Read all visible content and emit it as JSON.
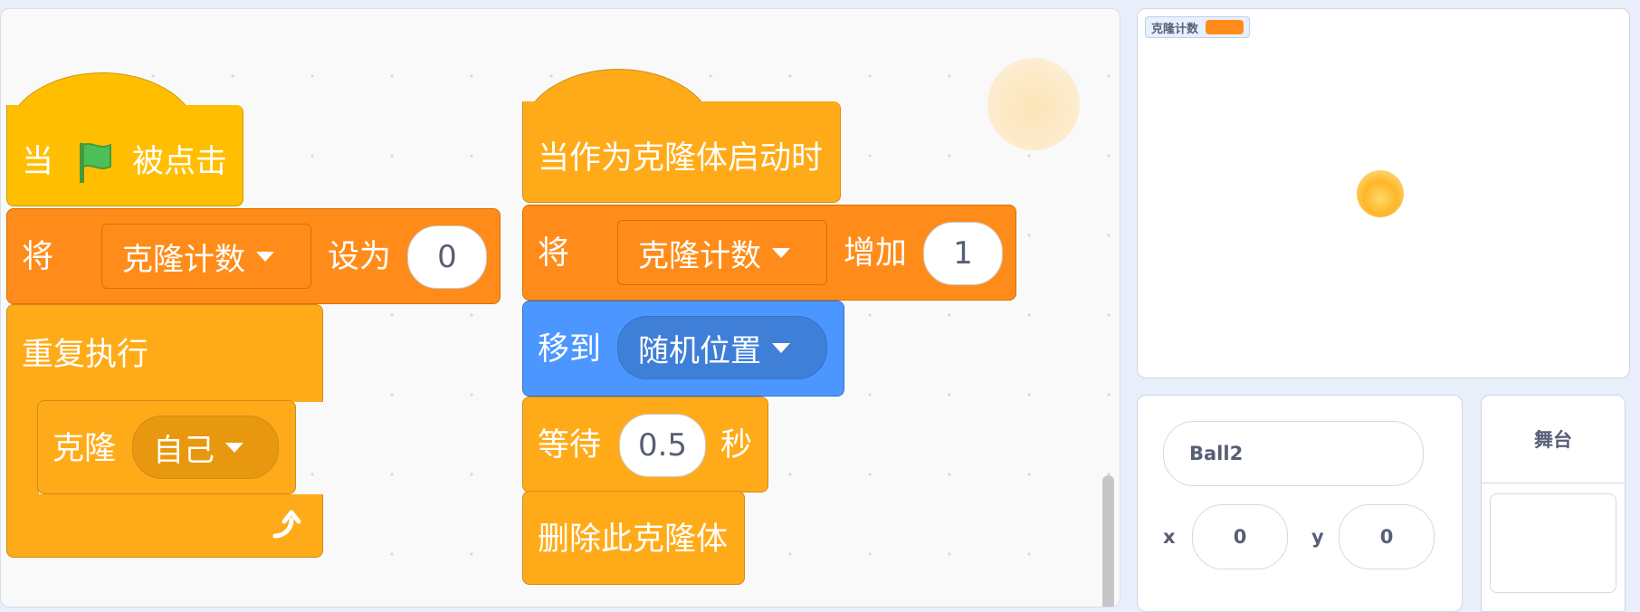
{
  "script_area": {
    "script1": {
      "hat": {
        "prefix": "当",
        "suffix": "被点击",
        "flag_icon": "green-flag-icon"
      },
      "set_var": {
        "prefix": "将",
        "variable": "克隆计数",
        "middle": "设为",
        "value": "0"
      },
      "forever": {
        "label": "重复执行"
      },
      "create_clone": {
        "prefix": "克隆",
        "target": "自己"
      }
    },
    "script2": {
      "hat": {
        "label": "当作为克隆体启动时"
      },
      "change_var": {
        "prefix": "将",
        "variable": "克隆计数",
        "middle": "增加",
        "value": "1"
      },
      "goto": {
        "prefix": "移到",
        "target": "随机位置"
      },
      "wait": {
        "prefix": "等待",
        "value": "0.5",
        "suffix": "秒"
      },
      "delete_clone": {
        "label": "删除此克隆体"
      }
    }
  },
  "stage": {
    "monitor_label": "克隆计数"
  },
  "sprite_info": {
    "name": "Ball2",
    "x_label": "x",
    "x_value": "0",
    "y_label": "y",
    "y_value": "0"
  },
  "stage_panel": {
    "title": "舞台"
  },
  "colors": {
    "events": "#ffbf00",
    "variables": "#ff8c1a",
    "control": "#ffab19",
    "motion": "#4c97ff"
  }
}
